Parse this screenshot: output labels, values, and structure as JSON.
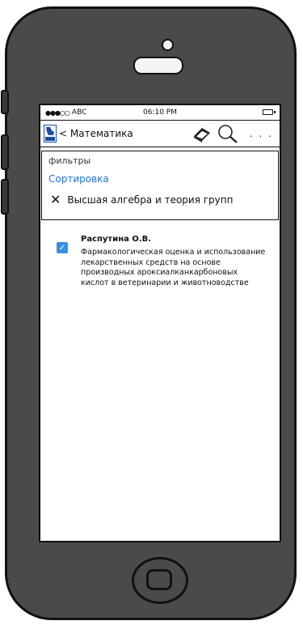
{
  "status_bar": {
    "carrier": "ABC",
    "time": "06:10 PM"
  },
  "navbar": {
    "back_label": "< Математика",
    "more_label": ". . ."
  },
  "filters": {
    "title": "фильтры",
    "sort_label": "Сортировка",
    "active_filter": "Высшая алгебра и теория групп"
  },
  "results": [
    {
      "author": "Распутина О.В.",
      "title": "Фармакологическая оценка и использование лекарственных средств на основе производных ароксиалканкарбоновых кислот в ветеринарии и животноводстве",
      "checked": true
    }
  ],
  "icons": {
    "logo": "logo-icon",
    "books": "books-icon",
    "search": "search-icon",
    "remove": "close-icon",
    "checkbox": "checkbox-icon"
  },
  "colors": {
    "accent": "#1e73d6",
    "checkbox": "#3a8fe0",
    "phone_body": "#4a4a4a"
  }
}
